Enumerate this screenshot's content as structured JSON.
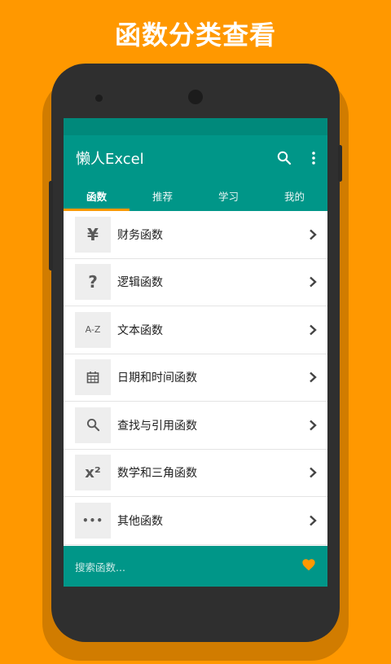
{
  "promo": {
    "title": "函数分类查看"
  },
  "app": {
    "title": "懒人Excel",
    "tabs": [
      {
        "label": "函数",
        "active": true
      },
      {
        "label": "推荐",
        "active": false
      },
      {
        "label": "学习",
        "active": false
      },
      {
        "label": "我的",
        "active": false
      }
    ]
  },
  "categories": [
    {
      "icon": "yen-icon",
      "glyph": "¥",
      "label": "财务函数"
    },
    {
      "icon": "question-icon",
      "glyph": "?",
      "label": "逻辑函数"
    },
    {
      "icon": "a-z-icon",
      "glyph": "A-Z",
      "label": "文本函数"
    },
    {
      "icon": "calendar-icon",
      "glyph": "",
      "label": "日期和时间函数"
    },
    {
      "icon": "search-icon",
      "glyph": "",
      "label": "查找与引用函数"
    },
    {
      "icon": "x-squared-icon",
      "glyph": "x²",
      "label": "数学和三角函数"
    },
    {
      "icon": "more-dots-icon",
      "glyph": "•••",
      "label": "其他函数"
    }
  ],
  "bottom": {
    "search_placeholder": "搜索函数..."
  },
  "colors": {
    "background": "#FF9800",
    "primary": "#009688",
    "accent": "#FF9800",
    "status_bar": "#00897B"
  }
}
